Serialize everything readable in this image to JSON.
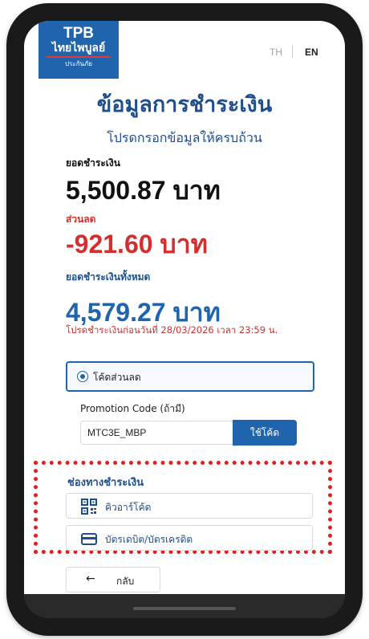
{
  "header": {
    "logo_line1": "TPB",
    "logo_line2": "ไทยไพบูลย์",
    "logo_line3": "ประกันภัย",
    "lang_th": "TH",
    "lang_en": "EN"
  },
  "page_title": "ข้อมูลการชำระเงิน",
  "subtitle": "โปรดกรอกข้อมูลให้ครบถ้วน",
  "payment": {
    "amount_label": "ยอดชำระเงิน",
    "amount_value": "5,500.87 บาท",
    "discount_label": "ส่วนลด",
    "discount_value": "-921.60 บาท",
    "total_label": "ยอดชำระเงินทั้งหมด",
    "total_value": "4,579.27 บาท",
    "deadline_text": "โปรดชำระเงินก่อนวันที่ 28/03/2026 เวลา 23:59 น."
  },
  "discount_option": {
    "label": "โค้ดส่วนลด",
    "selected": true
  },
  "promo": {
    "label": "Promotion Code (ถ้ามี)",
    "value": "MTC3E_MBP",
    "apply_button": "ใช้โค้ด"
  },
  "channels": {
    "title": "ช่องทางชำระเงิน",
    "items": [
      {
        "label": "คิวอาร์โค้ด",
        "icon": "qr-code-icon"
      },
      {
        "label": "บัตรเดบิต/บัตรเครดิต",
        "icon": "credit-card-icon"
      }
    ]
  },
  "back_button": {
    "label": "กลับ",
    "icon": "arrow-left-icon"
  },
  "colors": {
    "brand": "#1f64ad",
    "heading": "#1f4e8c",
    "danger": "#d32f2f",
    "highlight_dash": "#e02020"
  }
}
